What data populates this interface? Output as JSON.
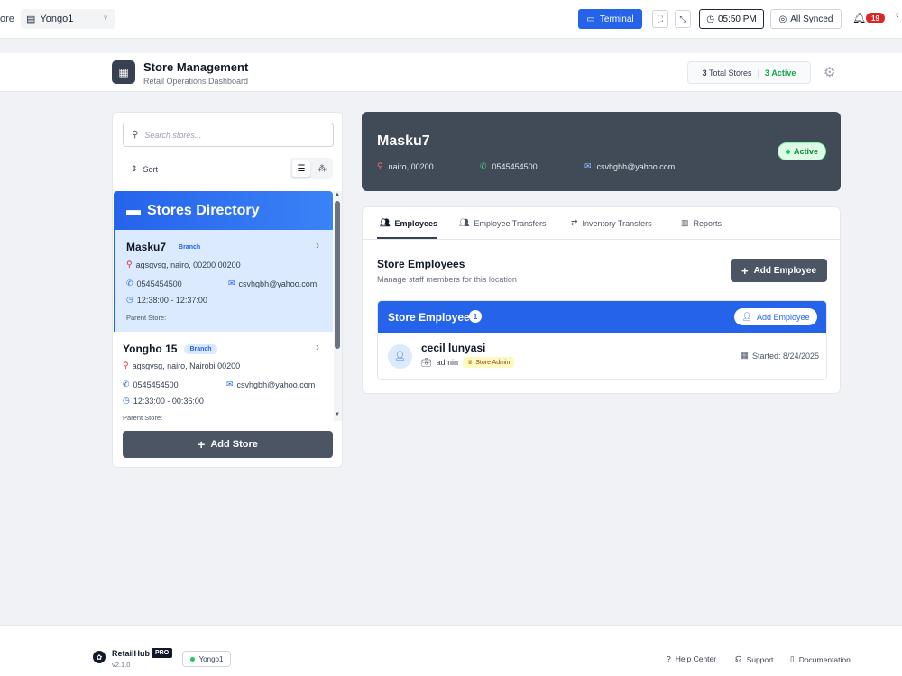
{
  "topbar": {
    "store_prefix": "ore",
    "store_select": "Yongo1",
    "terminal_label": "Terminal",
    "time": "05:50 PM",
    "sync_label": "All Synced",
    "notification_count": "19"
  },
  "header": {
    "title": "Store Management",
    "subtitle": "Retail Operations Dashboard",
    "total_count": "3",
    "total_label": "Total Stores",
    "active_count": "3",
    "active_label": "Active"
  },
  "left": {
    "search_placeholder": "Search stores...",
    "sort_label": "Sort",
    "directory_title": "Stores Directory",
    "stores": [
      {
        "name": "Masku7",
        "badge": "Branch",
        "address": "agsgvsg, nairo, 00200 00200",
        "phone": "0545454500",
        "email": "csvhgbh@yahoo.com",
        "hours": "12:38:00 - 12:37:00",
        "parent": "Parent Store:"
      },
      {
        "name": "Yongho 15",
        "badge": "Branch",
        "address": "agsgvsg, nairo, Nairobi 00200",
        "phone": "0545454500",
        "email": "csvhgbh@yahoo.com",
        "hours": "12:33:00 - 00:36:00",
        "parent": "Parent Store:"
      }
    ],
    "add_store_label": "Add Store"
  },
  "store_card": {
    "name": "Masku7",
    "location": "nairo, 00200",
    "phone": "0545454500",
    "email": "csvhgbh@yahoo.com",
    "status": "Active"
  },
  "tabs": [
    {
      "label": "Employees"
    },
    {
      "label": "Employee Transfers"
    },
    {
      "label": "Inventory Transfers"
    },
    {
      "label": "Reports"
    }
  ],
  "employees": {
    "section_title": "Store Employees",
    "section_subtitle": "Manage staff members for this location",
    "add_button": "Add Employee",
    "list_title": "Store Employees",
    "count": "1",
    "list_add_button": "Add Employee",
    "rows": [
      {
        "name": "cecil lunyasi",
        "role": "admin",
        "badge": "Store Admin",
        "started": "Started: 8/24/2025"
      }
    ]
  },
  "footer": {
    "app_name": "RetailHub",
    "pro_badge": "PRO",
    "version": "v2.1.0",
    "store": "Yongo1",
    "links": [
      "Help Center",
      "Support",
      "Documentation"
    ]
  },
  "colors": {
    "primary": "#2563eb",
    "dark": "#414a57",
    "success": "#16a34a",
    "danger": "#dc2626"
  }
}
